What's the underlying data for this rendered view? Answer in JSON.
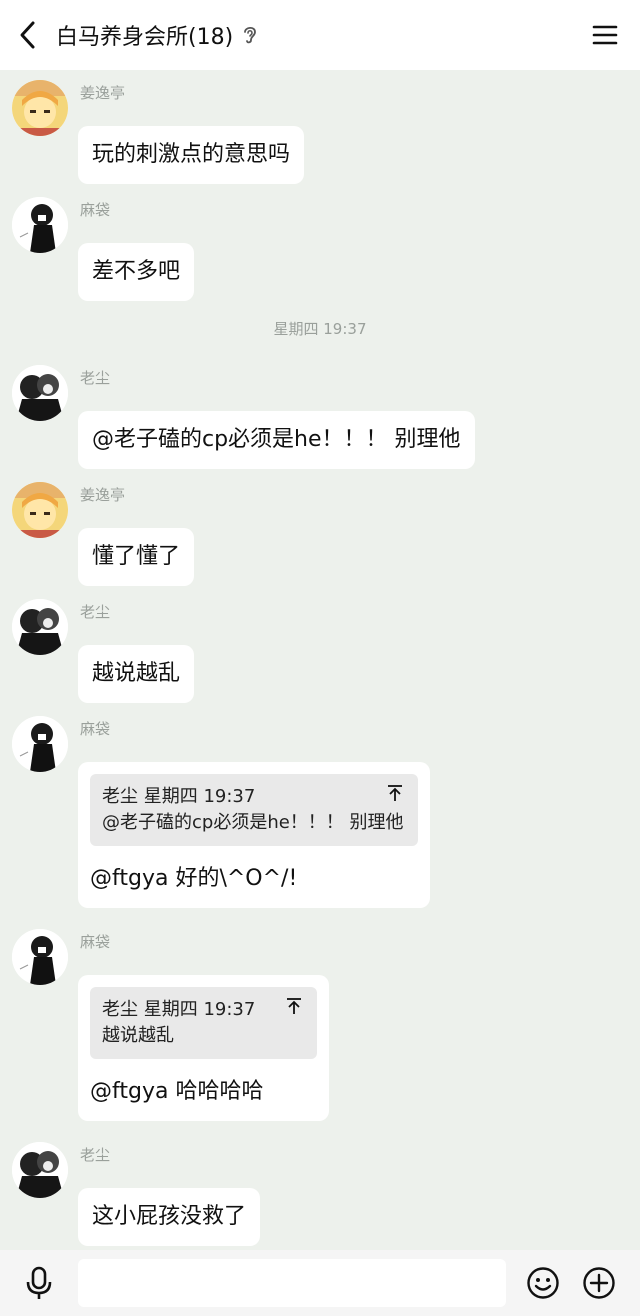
{
  "header": {
    "title": "白马养身会所(18)"
  },
  "messages": [
    {
      "sender": "姜逸亭",
      "text": "玩的刺激点的意思吗"
    },
    {
      "sender": "麻袋",
      "text": "差不多吧"
    },
    {
      "sender": "老尘",
      "text": "@老子磕的cp必须是he！！！ 别理他"
    },
    {
      "sender": "姜逸亭",
      "text": "懂了懂了"
    },
    {
      "sender": "老尘",
      "text": "越说越乱"
    },
    {
      "sender": "麻袋",
      "quote_header": "老尘 星期四 19:37",
      "quote_text": "@老子磕的cp必须是he！！！ 别理他",
      "text": "@ftgya 好的\\^O^/!"
    },
    {
      "sender": "麻袋",
      "quote_header": "老尘 星期四 19:37",
      "quote_text": "越说越乱",
      "text": "@ftgya 哈哈哈哈"
    },
    {
      "sender": "老尘",
      "text": "这小屁孩没救了"
    }
  ],
  "time_separator": "星期四 19:37",
  "icons": {
    "back": "chevron-left-icon",
    "ear": "ear-icon",
    "menu": "menu-icon",
    "mic": "microphone-icon",
    "emoji": "smiley-icon",
    "plus": "plus-circle-icon"
  },
  "colors": {
    "background": "#edf1ec",
    "bubble": "#ffffff",
    "quote": "#e9e9e9",
    "meta_text": "#9aa09b"
  }
}
